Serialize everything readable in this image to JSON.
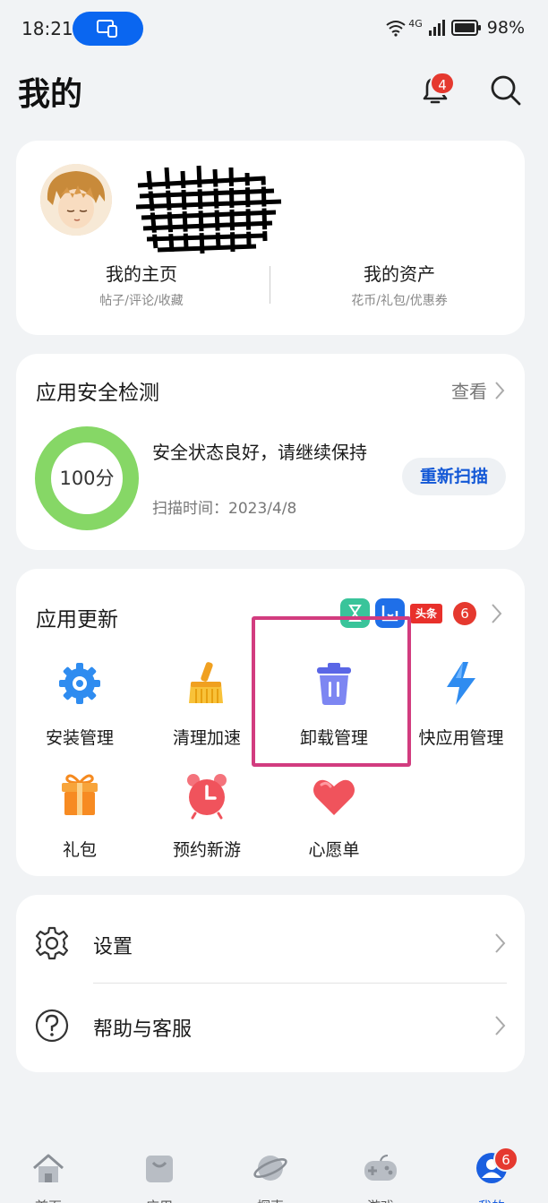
{
  "status_bar": {
    "time": "18:21",
    "network": "4G",
    "battery": "98%"
  },
  "header": {
    "title": "我的",
    "notification_count": "4"
  },
  "profile": {
    "left": {
      "title": "我的主页",
      "subtitle": "帖子/评论/收藏"
    },
    "right": {
      "title": "我的资产",
      "subtitle": "花币/礼包/优惠券"
    }
  },
  "security": {
    "title": "应用安全检测",
    "view_label": "查看",
    "score": "100分",
    "score_value": 100,
    "status": "安全状态良好，请继续保持",
    "scan_time": "扫描时间：2023/4/8",
    "rescan_label": "重新扫描",
    "ring_color": "#86d766"
  },
  "updates": {
    "title": "应用更新",
    "badge_count": "6",
    "app_icons": [
      "hourglass-app-icon",
      "blue-app-icon",
      "toutiao-app-icon"
    ],
    "toutiao_label": "头条",
    "tools": [
      {
        "label": "安装管理",
        "icon": "gear-icon"
      },
      {
        "label": "清理加速",
        "icon": "broom-icon"
      },
      {
        "label": "卸载管理",
        "icon": "trash-icon"
      },
      {
        "label": "快应用管理",
        "icon": "lightning-icon"
      },
      {
        "label": "礼包",
        "icon": "gift-icon"
      },
      {
        "label": "预约新游",
        "icon": "alarm-clock-icon"
      },
      {
        "label": "心愿单",
        "icon": "heart-icon"
      }
    ],
    "highlight_color": "#d23c7f"
  },
  "settings": {
    "items": [
      {
        "label": "设置",
        "icon": "gear-outline-icon"
      },
      {
        "label": "帮助与客服",
        "icon": "help-icon"
      }
    ]
  },
  "bottom_nav": {
    "items": [
      {
        "label": "首页",
        "icon": "home-icon"
      },
      {
        "label": "应用",
        "icon": "bag-icon"
      },
      {
        "label": "探索",
        "icon": "planet-icon"
      },
      {
        "label": "游戏",
        "icon": "gamepad-icon"
      },
      {
        "label": "我的",
        "icon": "person-icon",
        "active": true
      }
    ],
    "badge_count": "6",
    "active_color": "#1a5fe0"
  }
}
